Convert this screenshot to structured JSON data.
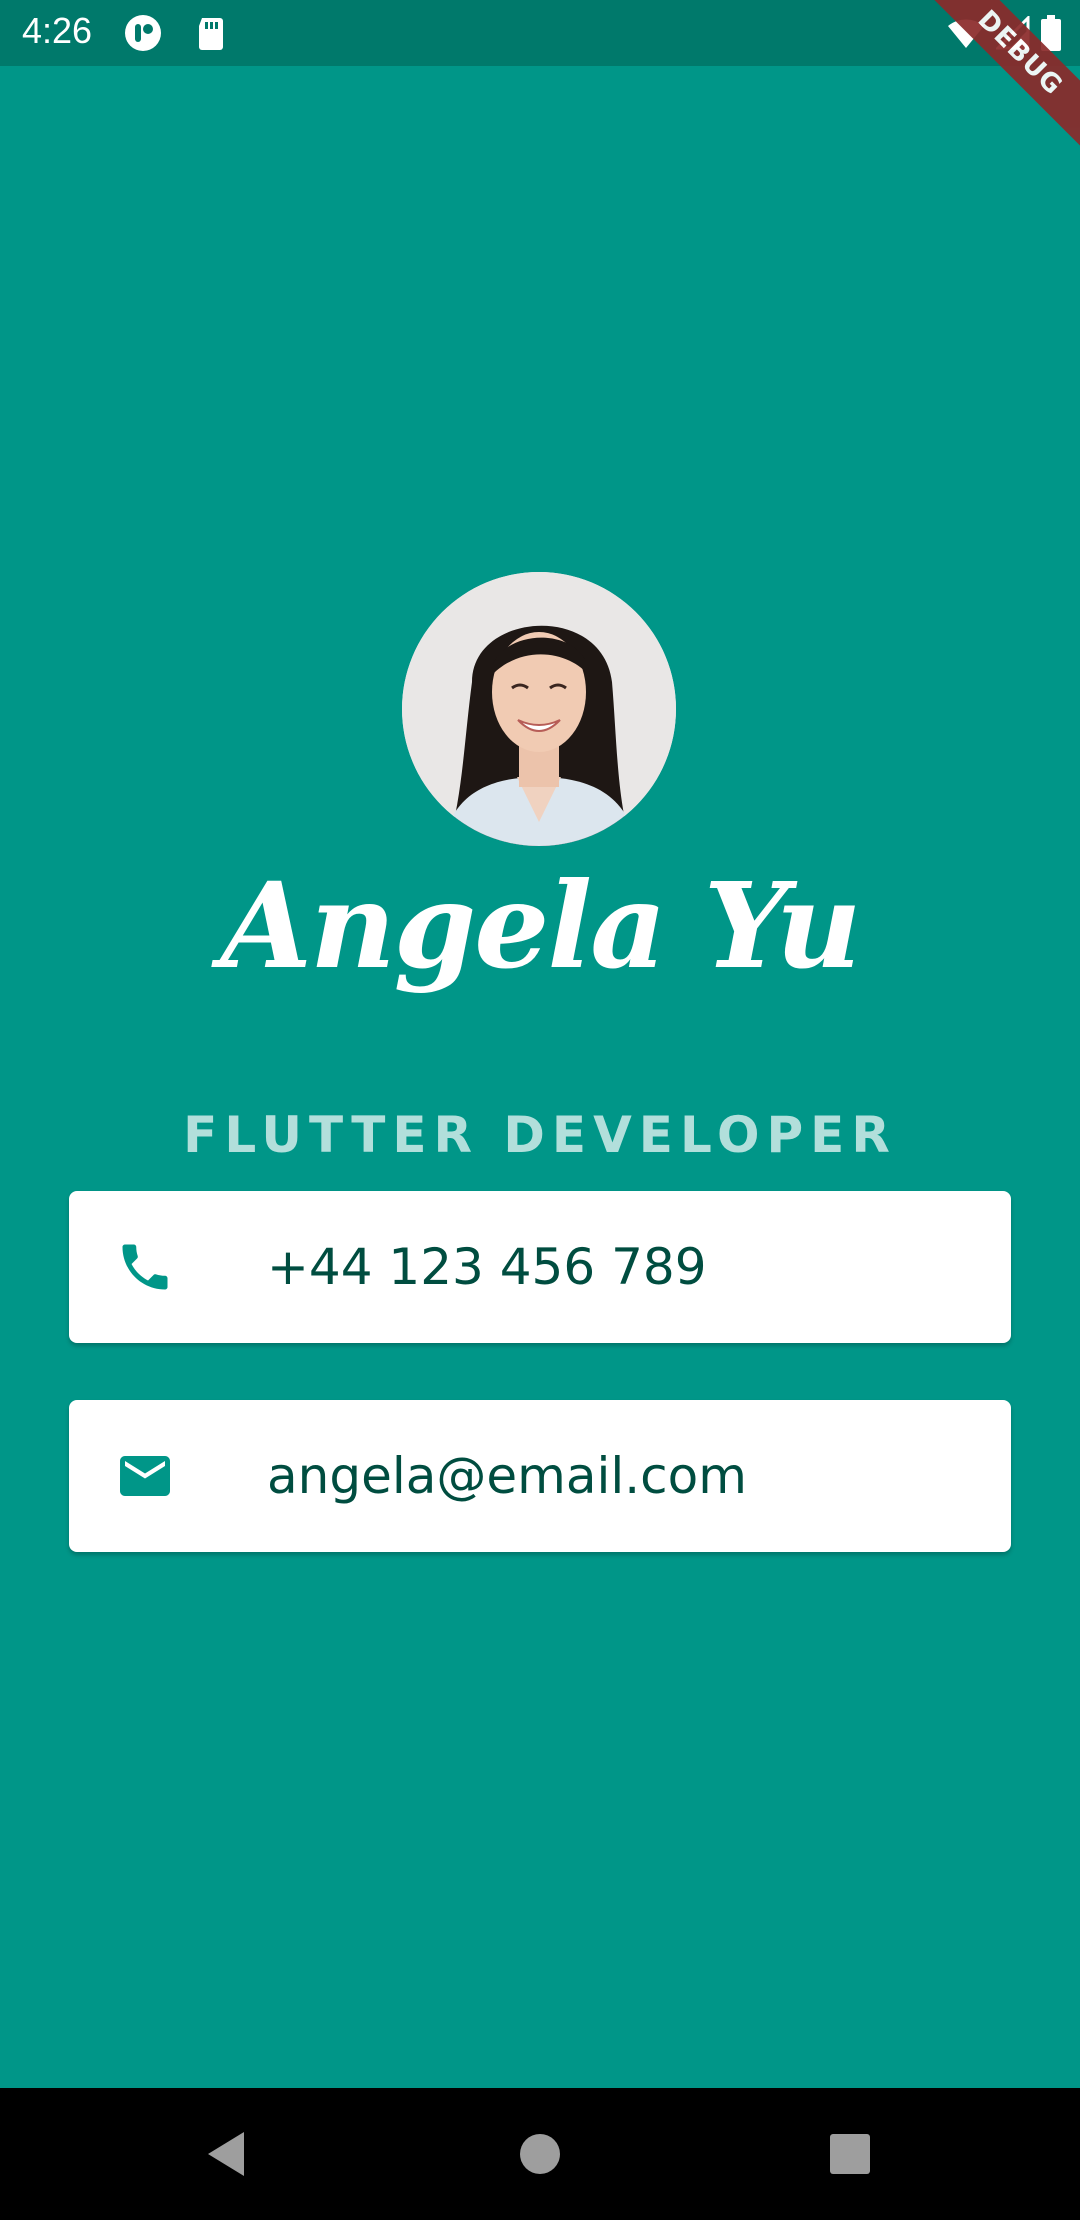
{
  "status_bar": {
    "time": "4:26",
    "left_icons": [
      "app-icon",
      "sd-card-icon"
    ],
    "right_icons": [
      "wifi-icon",
      "signal-icon",
      "battery-icon"
    ]
  },
  "debug_banner": "DEBUG",
  "profile": {
    "name": "Angela Yu",
    "title": "FLUTTER DEVELOPER",
    "avatar_icon": "profile-photo"
  },
  "contacts": {
    "phone": {
      "icon": "phone-icon",
      "value": "+44 123 456 789"
    },
    "email": {
      "icon": "mail-icon",
      "value": "angela@email.com"
    }
  },
  "nav_bar": {
    "buttons": [
      "back-icon",
      "home-icon",
      "recents-icon"
    ]
  },
  "colors": {
    "background": "#009688",
    "status_bar": "#00796b",
    "text_primary": "#004d40",
    "subtitle": "#b2dfdb",
    "card": "#ffffff"
  }
}
